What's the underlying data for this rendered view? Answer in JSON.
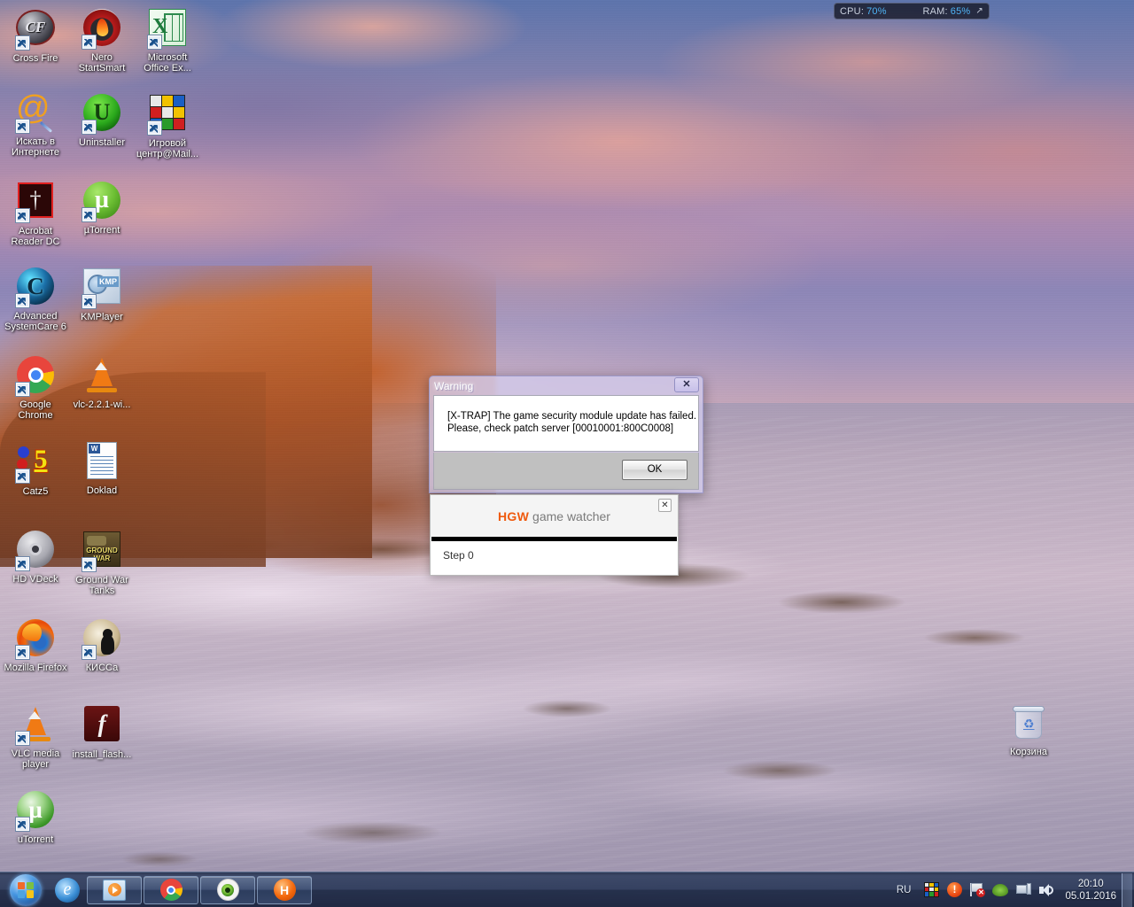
{
  "sysmon": {
    "cpu_label": "CPU:",
    "cpu_value": "70%",
    "ram_label": "RAM:",
    "ram_value": "65%",
    "expand_glyph": "↗",
    "value_color": "#4fb4f5"
  },
  "desktop": {
    "icons": [
      {
        "name": "cross-fire",
        "label": "Cross Fire",
        "icon": "crossfire-icon"
      },
      {
        "name": "nero-startsmart",
        "label": "Nero StartSmart",
        "icon": "nero-icon"
      },
      {
        "name": "microsoft-excel",
        "label": "Microsoft Office Ex...",
        "icon": "excel-icon"
      },
      {
        "name": "search-internet",
        "label": "Искать в Интернете",
        "icon": "search-web-icon"
      },
      {
        "name": "uninstaller",
        "label": "Uninstaller",
        "icon": "uninstaller-icon"
      },
      {
        "name": "mail-game-center",
        "label": "Игровой центр@Mail...",
        "icon": "rubik-cube-icon"
      },
      {
        "name": "acrobat-reader",
        "label": "Acrobat Reader DC",
        "icon": "acrobat-icon"
      },
      {
        "name": "utorrent-top",
        "label": "µTorrent",
        "icon": "utorrent-icon"
      },
      {
        "name": "advanced-systemcare",
        "label": "Advanced SystemCare 6",
        "icon": "systemcare-icon"
      },
      {
        "name": "kmplayer",
        "label": "KMPlayer",
        "icon": "kmplayer-icon"
      },
      {
        "name": "google-chrome",
        "label": "Google Chrome",
        "icon": "chrome-icon"
      },
      {
        "name": "vlc-installer",
        "label": "vlc-2.2.1-wi...",
        "icon": "vlc-cone-icon"
      },
      {
        "name": "catz5",
        "label": "Catz5",
        "icon": "catz5-icon"
      },
      {
        "name": "doklad",
        "label": "Doklad",
        "icon": "word-document-icon"
      },
      {
        "name": "hd-vdeck",
        "label": "HD VDeck",
        "icon": "hd-vdeck-icon"
      },
      {
        "name": "ground-war-tanks",
        "label": "Ground War Tanks",
        "icon": "ground-war-tanks-icon"
      },
      {
        "name": "mozilla-firefox",
        "label": "Mozilla Firefox",
        "icon": "firefox-icon"
      },
      {
        "name": "kissa",
        "label": "КИССа",
        "icon": "cat-icon"
      },
      {
        "name": "vlc-media-player",
        "label": "VLC media player",
        "icon": "vlc-cone-icon"
      },
      {
        "name": "install-flash",
        "label": "install_flash...",
        "icon": "flash-installer-icon"
      },
      {
        "name": "utorrent-bottom",
        "label": "uTorrent",
        "icon": "utorrent-icon"
      }
    ],
    "recycle_bin": {
      "label": "Корзина",
      "icon": "recycle-bin-icon"
    }
  },
  "warning_dialog": {
    "title": "Warning",
    "close_glyph": "✕",
    "message": "[X-TRAP] The game security module update has failed.\nPlease, check patch server [00010001:800C0008]",
    "ok_label": "OK"
  },
  "hgw_panel": {
    "brand": "HGW",
    "brand_color": "#ef5a0e",
    "subtitle": " game watcher",
    "close_glyph": "✕",
    "status": "Step 0"
  },
  "taskbar": {
    "start_label": "Start",
    "quick_launch": [
      {
        "name": "internet-explorer",
        "icon": "internet-explorer-icon",
        "label": "Internet Explorer"
      }
    ],
    "buttons": [
      {
        "name": "media-player",
        "icon": "media-player-icon",
        "label": ""
      },
      {
        "name": "chrome",
        "icon": "chrome-icon",
        "label": ""
      },
      {
        "name": "game-watcher",
        "icon": "green-eye-icon",
        "label": ""
      },
      {
        "name": "hgw",
        "icon": "hgw-orange-icon",
        "label": "H"
      }
    ],
    "tray": {
      "language": "RU",
      "icons": [
        {
          "name": "game-center-tray",
          "icon": "rubik-cube-icon"
        },
        {
          "name": "action-center",
          "icon": "alert-circle-icon",
          "glyph": "!"
        },
        {
          "name": "network-flag",
          "icon": "flag-error-icon",
          "glyph": "✕"
        },
        {
          "name": "nvidia",
          "icon": "nvidia-eye-icon"
        },
        {
          "name": "network",
          "icon": "network-icon"
        },
        {
          "name": "volume",
          "icon": "speaker-icon"
        }
      ],
      "time": "20:10",
      "date": "05.01.2016"
    }
  }
}
